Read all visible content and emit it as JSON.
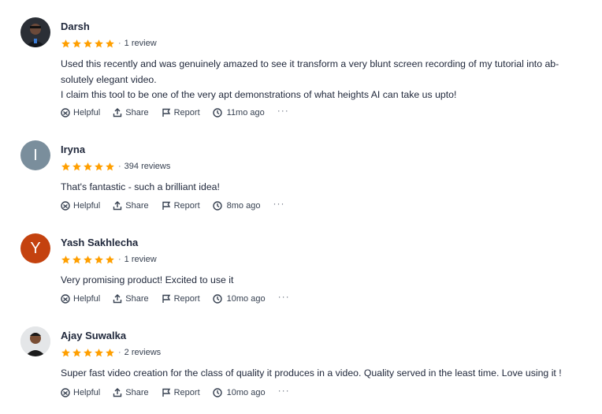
{
  "reviews": [
    {
      "name": "Darsh",
      "stars": 5,
      "count": "1 review",
      "avatar": "user-photo",
      "lines": [
        "Used this recently and was genuinely amazed to see it transform a very blunt screen recording of my tutorial into ab-",
        "solutely elegant video.",
        "I claim this tool to be one of the very apt demonstrations of what heights AI can take us upto!"
      ],
      "helpful": "Helpful",
      "share": "Share",
      "report": "Report",
      "time": "11mo ago",
      "more": "···"
    },
    {
      "name": "Iryna",
      "stars": 5,
      "count": "394 reviews",
      "avatar_letter": "I",
      "lines": [
        "That's fantastic - such a brilliant idea!"
      ],
      "helpful": "Helpful",
      "share": "Share",
      "report": "Report",
      "time": "8mo ago",
      "more": "···"
    },
    {
      "name": "Yash Sakhlecha",
      "stars": 5,
      "count": "1 review",
      "avatar_letter": "Y",
      "lines": [
        "Very promising product! Excited to use it"
      ],
      "helpful": "Helpful",
      "share": "Share",
      "report": "Report",
      "time": "10mo ago",
      "more": "···"
    },
    {
      "name": "Ajay Suwalka",
      "stars": 5,
      "count": "2 reviews",
      "avatar": "user-photo",
      "lines": [
        "Super fast video creation for the class of quality it produces in a video. Quality served in the least time. Love using it !"
      ],
      "helpful": "Helpful",
      "share": "Share",
      "report": "Report",
      "time": "10mo ago",
      "more": "···"
    }
  ],
  "colors": {
    "star": "#ff9f00",
    "text": "#21293c",
    "muted": "#374151"
  }
}
